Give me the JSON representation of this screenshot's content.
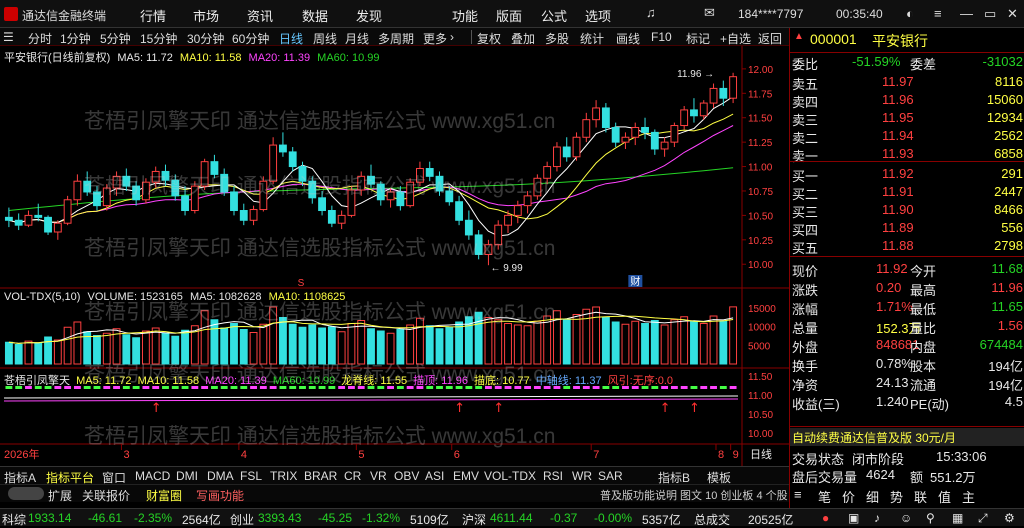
{
  "app": {
    "name": "通达信金融终端"
  },
  "menu": [
    "行情",
    "市场",
    "资讯",
    "数据",
    "发现",
    "功能",
    "版面",
    "公式",
    "选项"
  ],
  "account": "184****7797",
  "clock": "00:35:40",
  "toolbar": {
    "periods": [
      "分时",
      "1分钟",
      "5分钟",
      "15分钟",
      "30分钟",
      "60分钟",
      "日线",
      "周线",
      "月线",
      "多周期",
      "更多"
    ],
    "tools": [
      "复权",
      "叠加",
      "多股",
      "统计",
      "画线",
      "F10",
      "标记",
      "+自选",
      "返回"
    ],
    "selected": "日线"
  },
  "main_legend": {
    "title": "平安银行(日线前复权)",
    "ma5": "MA5: 11.72",
    "ma10": "MA10: 11.58",
    "ma20": "MA20: 11.39",
    "ma60": "MA60: 10.99"
  },
  "vol_legend": {
    "title": "VOL-TDX(5,10)",
    "vol": "VOLUME: 1523165",
    "ma5": "MA5: 1082628",
    "ma10": "MA10: 1108625"
  },
  "ind_legend": {
    "title": "苍梧引凤擎天",
    "ma5": "MA5: 11.72",
    "ma10": "MA10: 11.58",
    "ma20": "MA20: 11.39",
    "ma60": "MA60: 10.99",
    "tag1": "龙脊线: 11.55",
    "tag2": "描顶: 11.96",
    "tag3": "描底: 10.77",
    "tag4": "中轴线: 11.37",
    "tag5": "风引:无序:0.0"
  },
  "annotations": {
    "high": "11.96",
    "low": "9.99",
    "s_mark": "S",
    "cai_mark": "财"
  },
  "price_axis": [
    "12.00",
    "11.75",
    "11.50",
    "11.25",
    "11.00",
    "10.75",
    "10.50",
    "10.25",
    "10.00"
  ],
  "vol_axis": [
    "15000",
    "10000",
    "5000"
  ],
  "ind_axis": [
    "11.50",
    "11.00",
    "10.50",
    "10.00"
  ],
  "x_axis": {
    "year": "2026年",
    "months": [
      "2",
      "3",
      "4",
      "5",
      "6",
      "7",
      "8",
      "9"
    ],
    "period": "日线"
  },
  "bottom_tabs": [
    "指标A",
    "指标平台",
    "窗口",
    "MACD",
    "DMI",
    "DMA",
    "FSL",
    "TRIX",
    "BRAR",
    "CR",
    "VR",
    "OBV",
    "ASI",
    "EMV",
    "VOL-TDX",
    "RSI",
    "WR",
    "SAR",
    "指标B",
    "模板"
  ],
  "bottom_tabs2": [
    "扩展",
    "关联报价",
    "财富圈",
    "写画功能"
  ],
  "bottom_info": "普及版功能说明 图文 10 创业板 4 个股",
  "stock": {
    "code": "000001",
    "name": "平安银行"
  },
  "ratio": {
    "label": "委比",
    "val": "-51.59%",
    "label2": "委差",
    "val2": "-31032"
  },
  "asks": [
    {
      "l": "卖五",
      "p": "11.97",
      "v": "8116"
    },
    {
      "l": "卖四",
      "p": "11.96",
      "v": "15060"
    },
    {
      "l": "卖三",
      "p": "11.95",
      "v": "12934"
    },
    {
      "l": "卖二",
      "p": "11.94",
      "v": "2562"
    },
    {
      "l": "卖一",
      "p": "11.93",
      "v": "6858"
    }
  ],
  "bids": [
    {
      "l": "买一",
      "p": "11.92",
      "v": "291"
    },
    {
      "l": "买二",
      "p": "11.91",
      "v": "2447"
    },
    {
      "l": "买三",
      "p": "11.90",
      "v": "8466"
    },
    {
      "l": "买四",
      "p": "11.89",
      "v": "556"
    },
    {
      "l": "买五",
      "p": "11.88",
      "v": "2798"
    }
  ],
  "stats": [
    {
      "l1": "现价",
      "v1": "11.92",
      "l2": "今开",
      "v2": "11.68"
    },
    {
      "l1": "涨跌",
      "v1": "0.20",
      "l2": "最高",
      "v2": "11.96"
    },
    {
      "l1": "涨幅",
      "v1": "1.71%",
      "l2": "最低",
      "v2": "11.65"
    },
    {
      "l1": "总量",
      "v1": "152.3万",
      "l2": "量比",
      "v2": "1.56"
    },
    {
      "l1": "外盘",
      "v1": "848681",
      "l2": "内盘",
      "v2": "674484"
    },
    {
      "l1": "换手",
      "v1": "0.78%",
      "l2": "股本",
      "v2": "194亿"
    },
    {
      "l1": "净资",
      "v1": "24.13",
      "l2": "流通",
      "v2": "194亿"
    },
    {
      "l1": "收益(三)",
      "v1": "1.240",
      "l2": "PE(动)",
      "v2": "4.5"
    }
  ],
  "promo": "自动续费通达信普及版 30元/月",
  "trade": {
    "phase_l": "交易状态",
    "phase": "闭市阶段",
    "time": "15:33:06",
    "after_l": "盘后交易量",
    "after_v": "4624",
    "amt_l": "额",
    "amt_v": "551.2万"
  },
  "status": [
    {
      "n": "科综",
      "v": "1933.14",
      "c": "-46.61",
      "p": "-2.35%",
      "a": "2564亿"
    },
    {
      "n": "创业",
      "v": "3393.43",
      "c": "-45.25",
      "p": "-1.32%",
      "a": "5109亿"
    },
    {
      "n": "沪深",
      "v": "4611.44",
      "c": "-0.37",
      "p": "-0.00%",
      "a": "5357亿"
    },
    {
      "n": "总成交",
      "v": "",
      "c": "",
      "p": "",
      "a": "20525亿"
    }
  ],
  "watermark": "苍梧引凤擎天印 通达信选股指标公式 www.xg51.cn",
  "colors": {
    "up": "#ff4040",
    "down": "#25d425",
    "ma5": "#ffffff",
    "ma10": "#ffff44",
    "ma20": "#ff44ff",
    "ma60": "#25d425",
    "bg": "#000000"
  },
  "chart_data": {
    "type": "candlestick",
    "ylim": [
      9.9,
      12.05
    ],
    "ohlc": [
      [
        10.48,
        10.58,
        10.38,
        10.45
      ],
      [
        10.45,
        10.52,
        10.35,
        10.4
      ],
      [
        10.4,
        10.55,
        10.38,
        10.5
      ],
      [
        10.5,
        10.62,
        10.44,
        10.48
      ],
      [
        10.48,
        10.5,
        10.3,
        10.33
      ],
      [
        10.33,
        10.45,
        10.25,
        10.42
      ],
      [
        10.42,
        10.7,
        10.4,
        10.66
      ],
      [
        10.66,
        10.92,
        10.6,
        10.85
      ],
      [
        10.85,
        10.95,
        10.7,
        10.74
      ],
      [
        10.74,
        10.8,
        10.55,
        10.6
      ],
      [
        10.6,
        10.82,
        10.55,
        10.78
      ],
      [
        10.78,
        10.95,
        10.7,
        10.9
      ],
      [
        10.9,
        10.98,
        10.75,
        10.8
      ],
      [
        10.8,
        10.85,
        10.6,
        10.66
      ],
      [
        10.66,
        10.88,
        10.62,
        10.84
      ],
      [
        10.84,
        11.0,
        10.78,
        10.95
      ],
      [
        10.95,
        11.02,
        10.8,
        10.86
      ],
      [
        10.86,
        10.92,
        10.65,
        10.7
      ],
      [
        10.7,
        10.8,
        10.5,
        10.55
      ],
      [
        10.55,
        10.85,
        10.52,
        10.8
      ],
      [
        10.8,
        11.08,
        10.76,
        11.05
      ],
      [
        11.05,
        11.12,
        10.88,
        10.92
      ],
      [
        10.92,
        10.98,
        10.7,
        10.74
      ],
      [
        10.74,
        10.8,
        10.5,
        10.55
      ],
      [
        10.55,
        10.62,
        10.4,
        10.45
      ],
      [
        10.45,
        10.6,
        10.4,
        10.56
      ],
      [
        10.56,
        10.9,
        10.54,
        10.85
      ],
      [
        10.85,
        11.3,
        10.82,
        11.22
      ],
      [
        11.22,
        11.35,
        11.1,
        11.15
      ],
      [
        11.15,
        11.2,
        10.95,
        11.0
      ],
      [
        11.0,
        11.05,
        10.8,
        10.85
      ],
      [
        10.85,
        10.9,
        10.62,
        10.68
      ],
      [
        10.68,
        10.75,
        10.5,
        10.55
      ],
      [
        10.55,
        10.6,
        10.38,
        10.42
      ],
      [
        10.42,
        10.55,
        10.36,
        10.5
      ],
      [
        10.5,
        10.8,
        10.48,
        10.76
      ],
      [
        10.76,
        10.95,
        10.7,
        10.9
      ],
      [
        10.9,
        11.02,
        10.78,
        10.82
      ],
      [
        10.82,
        10.85,
        10.6,
        10.66
      ],
      [
        10.66,
        10.78,
        10.58,
        10.74
      ],
      [
        10.74,
        10.8,
        10.55,
        10.6
      ],
      [
        10.6,
        10.88,
        10.58,
        10.84
      ],
      [
        10.84,
        11.05,
        10.8,
        10.98
      ],
      [
        10.98,
        11.05,
        10.85,
        10.9
      ],
      [
        10.9,
        10.95,
        10.7,
        10.75
      ],
      [
        10.75,
        10.8,
        10.6,
        10.64
      ],
      [
        10.64,
        10.7,
        10.4,
        10.45
      ],
      [
        10.45,
        10.55,
        10.25,
        10.3
      ],
      [
        10.3,
        10.35,
        10.05,
        10.1
      ],
      [
        10.1,
        10.25,
        9.99,
        10.2
      ],
      [
        10.2,
        10.45,
        10.15,
        10.4
      ],
      [
        10.4,
        10.55,
        10.32,
        10.5
      ],
      [
        10.5,
        10.65,
        10.42,
        10.6
      ],
      [
        10.6,
        10.75,
        10.52,
        10.7
      ],
      [
        10.7,
        10.92,
        10.66,
        10.88
      ],
      [
        10.88,
        11.05,
        10.82,
        11.0
      ],
      [
        11.0,
        11.25,
        10.95,
        11.2
      ],
      [
        11.2,
        11.3,
        11.05,
        11.1
      ],
      [
        11.1,
        11.35,
        11.06,
        11.3
      ],
      [
        11.3,
        11.55,
        11.25,
        11.48
      ],
      [
        11.48,
        11.68,
        11.4,
        11.6
      ],
      [
        11.6,
        11.65,
        11.35,
        11.4
      ],
      [
        11.4,
        11.45,
        11.2,
        11.25
      ],
      [
        11.25,
        11.35,
        11.18,
        11.3
      ],
      [
        11.3,
        11.45,
        11.22,
        11.4
      ],
      [
        11.4,
        11.5,
        11.28,
        11.35
      ],
      [
        11.35,
        11.38,
        11.12,
        11.18
      ],
      [
        11.18,
        11.3,
        11.1,
        11.25
      ],
      [
        11.25,
        11.45,
        11.2,
        11.42
      ],
      [
        11.42,
        11.62,
        11.38,
        11.58
      ],
      [
        11.58,
        11.7,
        11.45,
        11.52
      ],
      [
        11.52,
        11.68,
        11.48,
        11.65
      ],
      [
        11.65,
        11.85,
        11.6,
        11.8
      ],
      [
        11.8,
        11.88,
        11.62,
        11.7
      ],
      [
        11.7,
        11.96,
        11.65,
        11.92
      ]
    ],
    "volume": [
      5800,
      5200,
      6100,
      5600,
      7200,
      6400,
      9800,
      11200,
      8600,
      7600,
      8200,
      9400,
      7800,
      7000,
      8800,
      9600,
      8200,
      7400,
      9000,
      10200,
      14200,
      11800,
      9600,
      10800,
      9200,
      8400,
      10600,
      15200,
      12400,
      10600,
      9800,
      10400,
      9600,
      9900,
      8600,
      10800,
      11600,
      9400,
      8800,
      8200,
      9200,
      10400,
      12200,
      10200,
      9400,
      9800,
      11200,
      12600,
      13800,
      12400,
      11800,
      10800,
      10400,
      10200,
      11400,
      12800,
      14200,
      11800,
      13200,
      14600,
      15200,
      12400,
      11200,
      10600,
      11400,
      10800,
      11600,
      10400,
      11800,
      12600,
      11200,
      10800,
      12800,
      11400,
      15231
    ]
  }
}
